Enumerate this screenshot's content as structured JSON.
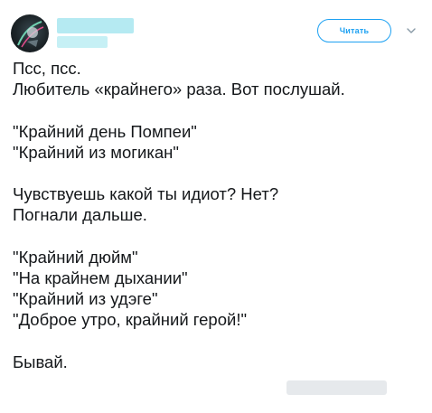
{
  "author": {
    "avatar_icon": "profile-avatar",
    "name": "",
    "handle": ""
  },
  "actions": {
    "follow_label": "Читать",
    "menu_icon": "chevron-down-icon",
    "accent_color": "#1da1f2"
  },
  "tweet": {
    "lines": [
      "Псс, псс.",
      "Любитель «крайнего» раза. Вот послушай.",
      "",
      "\"Крайний день Помпеи\"",
      "\"Крайний из могикан\"",
      "",
      "Чувствуешь какой ты идиот? Нет?",
      "Погнали дальше.",
      "",
      "\"Крайний дюйм\"",
      "\"На крайнем дыхании\"",
      "\"Крайний из удэге\"",
      "\"Доброе утро, крайний герой!\"",
      "",
      "Бывай."
    ]
  }
}
